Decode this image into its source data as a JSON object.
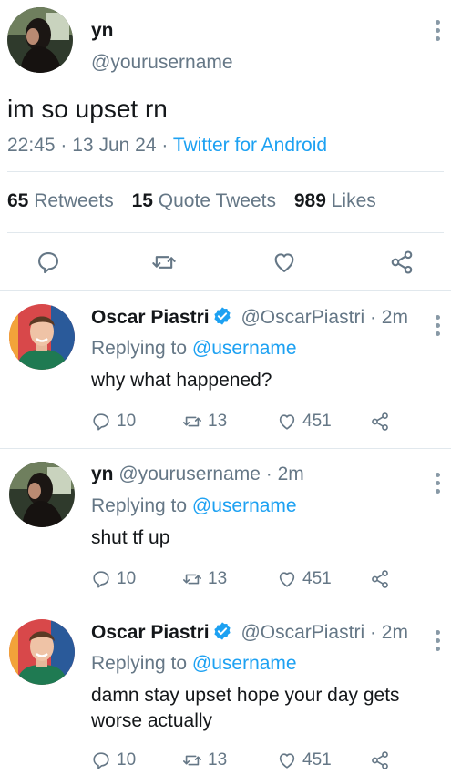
{
  "main_tweet": {
    "name": "yn",
    "handle": "@yourusername",
    "text": "im so upset rn",
    "time": "22:45",
    "dot1": "·",
    "date": "13 Jun 24",
    "dot2": "·",
    "source": "Twitter for Android",
    "retweets_count": "65",
    "retweets_label": "Retweets",
    "quotes_count": "15",
    "quotes_label": "Quote Tweets",
    "likes_count": "989",
    "likes_label": "Likes",
    "actions": {
      "reply_icon": "reply-icon",
      "retweet_icon": "retweet-icon",
      "like_icon": "heart-icon",
      "share_icon": "share-icon"
    }
  },
  "replies": [
    {
      "name": "Oscar Piastri",
      "verified": true,
      "handle": "@OscarPiastri",
      "time": "· 2m",
      "replying_prefix": "Replying to",
      "replying_to": "@username",
      "text": "why what happened?",
      "reply_count": "10",
      "retweet_count": "13",
      "like_count": "451"
    },
    {
      "name": "yn",
      "verified": false,
      "handle": "@yourusername",
      "time": "· 2m",
      "replying_prefix": "Replying to",
      "replying_to": "@username",
      "text": "shut tf up",
      "reply_count": "10",
      "retweet_count": "13",
      "like_count": "451"
    },
    {
      "name": "Oscar Piastri",
      "verified": true,
      "handle": "@OscarPiastri",
      "time": "· 2m",
      "replying_prefix": "Replying to",
      "replying_to": "@username",
      "text": "damn stay upset hope your day gets worse actually",
      "reply_count": "10",
      "retweet_count": "13",
      "like_count": "451"
    }
  ],
  "colors": {
    "accent": "#1da1f2",
    "muted": "#657786",
    "text": "#14171a",
    "divider": "#e1e8ed"
  }
}
